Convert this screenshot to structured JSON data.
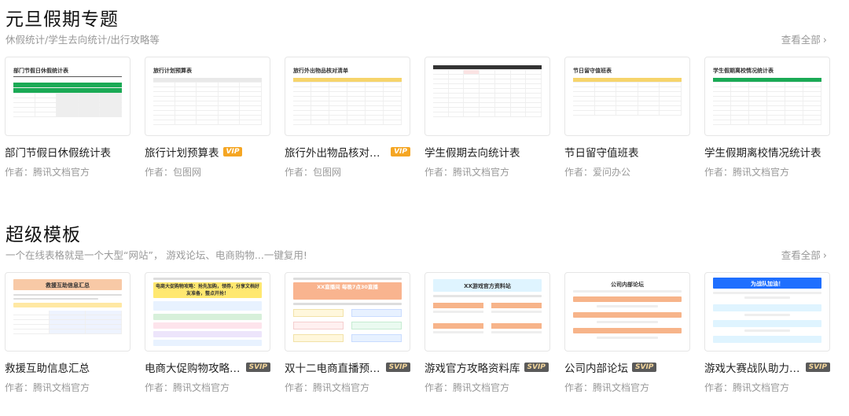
{
  "section1": {
    "title": "元旦假期专题",
    "subtitle": "休假统计/学生去向统计/出行攻略等",
    "view_all": "查看全部",
    "cards": [
      {
        "title": "部门节假日休假统计表",
        "author": "作者：腾讯文档官方",
        "badge": "",
        "thumb_title": "部门节假日休假统计表"
      },
      {
        "title": "旅行计划预算表",
        "author": "作者：包图网",
        "badge": "VIP",
        "thumb_title": "旅行计划预算表"
      },
      {
        "title": "旅行外出物品核对清单",
        "author": "作者：包图网",
        "badge": "VIP",
        "thumb_title": "旅行外出物品核对清单"
      },
      {
        "title": "学生假期去向统计表",
        "author": "作者：腾讯文档官方",
        "badge": "",
        "thumb_title": ""
      },
      {
        "title": "节日留守值班表",
        "author": "作者：爱问办公",
        "badge": "",
        "thumb_title": "节日留守值班表"
      },
      {
        "title": "学生假期离校情况统计表",
        "author": "作者：腾讯文档官方",
        "badge": "",
        "thumb_title": "学生假期离校情况统计表"
      }
    ]
  },
  "section2": {
    "title": "超级模板",
    "subtitle": "一个在线表格就是一个大型“网站”， 游戏论坛、电商购物...一键复用!",
    "view_all": "查看全部",
    "cards": [
      {
        "title": "救援互助信息汇总",
        "author": "作者：腾讯文档官方",
        "badge": "",
        "thumb_title": "救援互助信息汇总"
      },
      {
        "title": "电商大促购物攻略商...",
        "author": "作者：腾讯文档官方",
        "badge": "SVIP",
        "thumb_title": "电商大促购物攻略：抢先加购，领券，分享文档好友准备，整点开抢！"
      },
      {
        "title": "双十二电商直播预告...",
        "author": "作者：腾讯文档官方",
        "badge": "SVIP",
        "thumb_title": "XX直播间 每晚7点30直播"
      },
      {
        "title": "游戏官方攻略资料库",
        "author": "作者：腾讯文档官方",
        "badge": "SVIP",
        "thumb_title": "XX游戏官方资料站"
      },
      {
        "title": "公司内部论坛",
        "author": "作者：腾讯文档官方",
        "badge": "SVIP",
        "thumb_title": "公司内部论坛"
      },
      {
        "title": "游戏大赛战队助力文档",
        "author": "作者：腾讯文档官方",
        "badge": "SVIP",
        "thumb_title": "为战队加油！"
      }
    ]
  }
}
